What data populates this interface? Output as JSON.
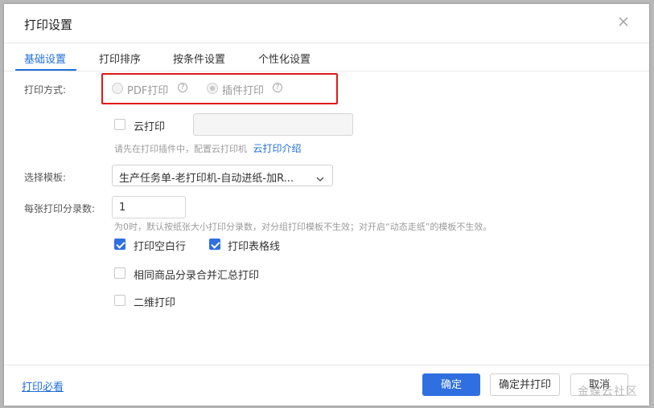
{
  "dialog": {
    "title": "打印设置",
    "close_icon": "close-icon"
  },
  "tabs": [
    {
      "label": "基础设置",
      "active": true
    },
    {
      "label": "打印排序",
      "active": false
    },
    {
      "label": "按条件设置",
      "active": false
    },
    {
      "label": "个性化设置",
      "active": false
    }
  ],
  "print_mode": {
    "label": "打印方式:",
    "options": [
      {
        "label": "PDF打印",
        "selected": false,
        "help_icon": "question-icon"
      },
      {
        "label": "插件打印",
        "selected": true,
        "help_icon": "question-icon"
      }
    ],
    "help_glyph": "?"
  },
  "cloud_print": {
    "label": "云打印",
    "checked": false,
    "input_value": "",
    "hint": "请先在打印插件中，配置云打印机",
    "hint_link": "云打印介绍"
  },
  "template": {
    "label": "选择模板:",
    "selected": "生产任务单-老打印机-自动进纸-加R..."
  },
  "copies": {
    "label": "每张打印分录数:",
    "value": "1",
    "hint": "为0时，默认按纸张大小打印分录数，对分组打印模板不生效；对开启“动态走纸”的模板不生效。"
  },
  "options": [
    {
      "label": "打印空白行",
      "checked": true
    },
    {
      "label": "打印表格线",
      "checked": true
    },
    {
      "label": "相同商品分录合并汇总打印",
      "checked": false
    },
    {
      "label": "二维打印",
      "checked": false
    }
  ],
  "footer": {
    "help_link": "打印必看",
    "confirm": "确定",
    "confirm_print": "确定并打印",
    "cancel": "取消"
  },
  "watermark": "金蝶云社区",
  "colors": {
    "accent": "#2f6fe0",
    "highlight": "#e01818"
  }
}
